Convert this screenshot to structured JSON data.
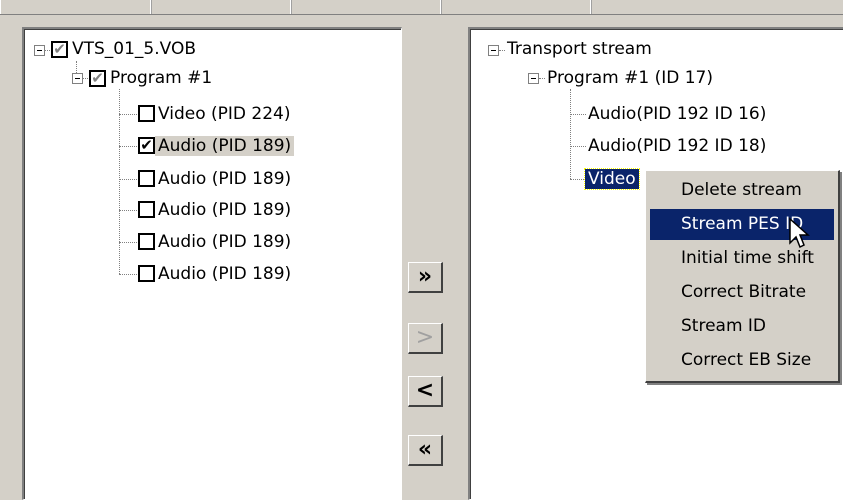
{
  "source_tree": {
    "root": {
      "label": "VTS_01_5.VOB",
      "checked": "partial"
    },
    "program": {
      "label": "Program #1",
      "checked": "partial"
    },
    "streams": [
      {
        "label": "Video (PID 224)",
        "checked": false
      },
      {
        "label": "Audio (PID 189)",
        "checked": true
      },
      {
        "label": "Audio (PID 189)",
        "checked": false
      },
      {
        "label": "Audio (PID 189)",
        "checked": false
      },
      {
        "label": "Audio (PID 189)",
        "checked": false
      },
      {
        "label": "Audio (PID 189)",
        "checked": false
      }
    ]
  },
  "buttons": {
    "add_all": "»",
    "add": ">",
    "remove": "<",
    "remove_all": "«"
  },
  "target_tree": {
    "root": {
      "label": "Transport stream"
    },
    "program": {
      "label": "Program #1 (ID 17)"
    },
    "streams": [
      {
        "label": "Audio(PID 192 ID 16)"
      },
      {
        "label": "Audio(PID 192 ID 18)"
      },
      {
        "label": "Video"
      }
    ]
  },
  "context_menu": {
    "items": [
      {
        "label": "Delete stream"
      },
      {
        "label": "Stream PES ID"
      },
      {
        "label": "Initial time shift"
      },
      {
        "label": "Correct Bitrate"
      },
      {
        "label": "Stream ID"
      },
      {
        "label": "Correct EB Size"
      }
    ],
    "highlighted_index": 1
  },
  "colors": {
    "selection": "#0a246a",
    "face": "#d4d0c8"
  }
}
